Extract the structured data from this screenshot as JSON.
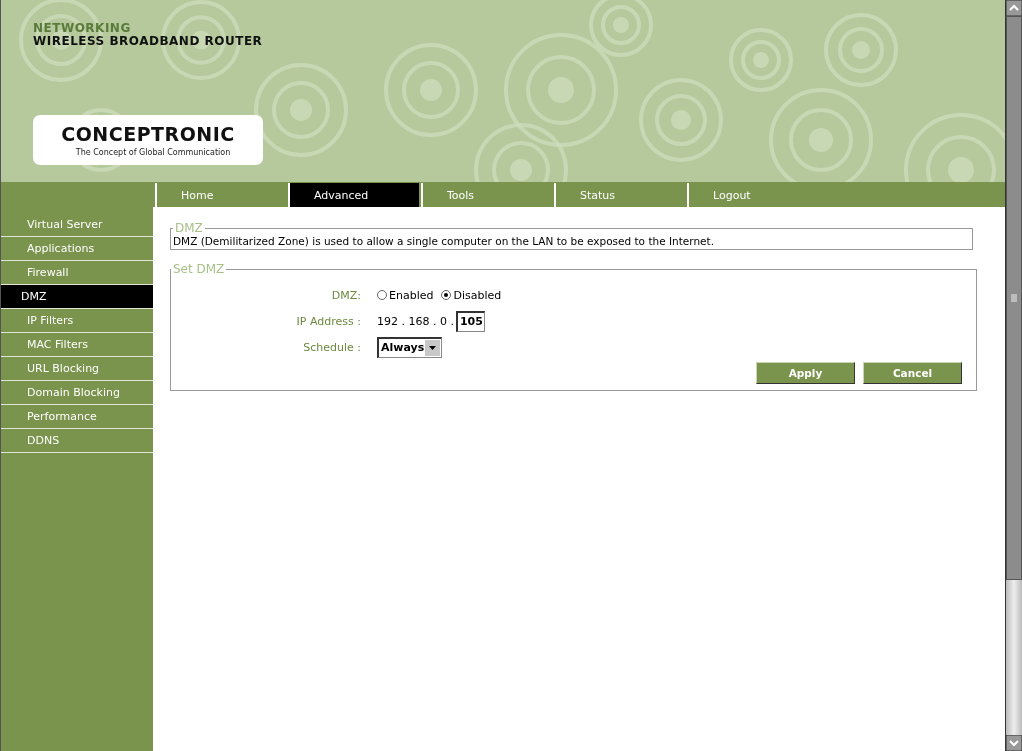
{
  "header": {
    "category": "NETWORKING",
    "product": "WIRELESS BROADBAND ROUTER",
    "logo": {
      "brand": "CONCEPTRONIC",
      "tagline": "The Concept of Global Communication"
    }
  },
  "tabs": [
    {
      "label": "Home",
      "selected": false
    },
    {
      "label": "Advanced",
      "selected": true
    },
    {
      "label": "Tools",
      "selected": false
    },
    {
      "label": "Status",
      "selected": false
    },
    {
      "label": "Logout",
      "selected": false
    }
  ],
  "sidebar": {
    "items": [
      {
        "label": "Virtual Server",
        "selected": false
      },
      {
        "label": "Applications",
        "selected": false
      },
      {
        "label": "Firewall",
        "selected": false
      },
      {
        "label": "DMZ",
        "selected": true
      },
      {
        "label": "IP Filters",
        "selected": false
      },
      {
        "label": "MAC Filters",
        "selected": false
      },
      {
        "label": "URL Blocking",
        "selected": false
      },
      {
        "label": "Domain Blocking",
        "selected": false
      },
      {
        "label": "Performance",
        "selected": false
      },
      {
        "label": "DDNS",
        "selected": false
      }
    ]
  },
  "info": {
    "legend": "DMZ",
    "text": "DMZ (Demilitarized Zone) is used to allow a single computer on the LAN to be exposed to the Internet."
  },
  "form": {
    "legend": "Set DMZ",
    "dmz": {
      "label": "DMZ:",
      "options": [
        {
          "label": "Enabled",
          "selected": false
        },
        {
          "label": "Disabled",
          "selected": true
        }
      ]
    },
    "ip": {
      "label": "IP Address :",
      "prefix": "192 . 168 . 0 .",
      "value": "105"
    },
    "schedule": {
      "label": "Schedule :",
      "value": "Always"
    },
    "buttons": [
      "Apply",
      "Cancel"
    ]
  }
}
